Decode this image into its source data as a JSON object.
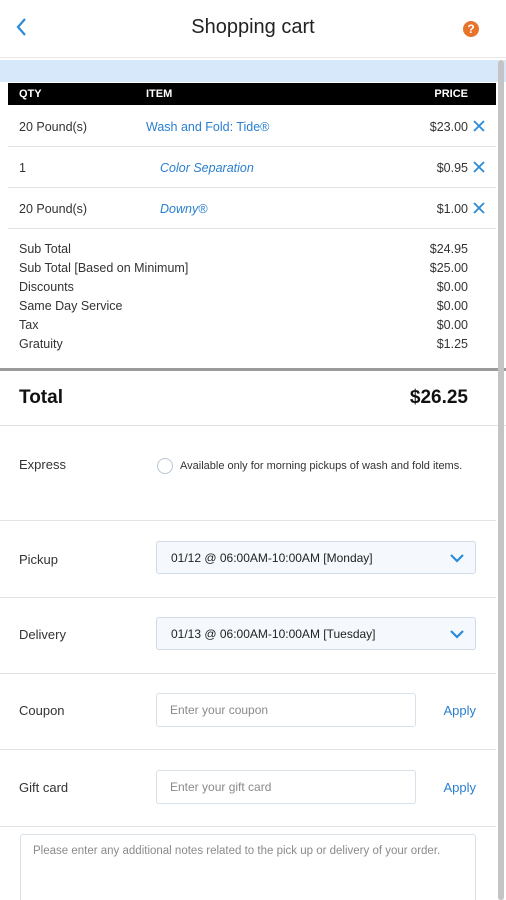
{
  "header": {
    "title": "Shopping cart",
    "help_glyph": "?"
  },
  "table": {
    "headers": {
      "qty": "QTY",
      "item": "ITEM",
      "price": "PRICE"
    },
    "rows": [
      {
        "qty": "20 Pound(s)",
        "item": "Wash and Fold: Tide®",
        "price": "$23.00"
      },
      {
        "qty": "1",
        "item": "Color Separation",
        "price": "$0.95"
      },
      {
        "qty": "20 Pound(s)",
        "item": "Downy®",
        "price": "$1.00"
      }
    ]
  },
  "summary": [
    {
      "label": "Sub Total",
      "value": "$24.95"
    },
    {
      "label": "Sub Total [Based on Minimum]",
      "value": "$25.00"
    },
    {
      "label": "Discounts",
      "value": "$0.00"
    },
    {
      "label": "Same Day Service",
      "value": "$0.00"
    },
    {
      "label": "Tax",
      "value": "$0.00"
    },
    {
      "label": "Gratuity",
      "value": "$1.25"
    }
  ],
  "total": {
    "label": "Total",
    "value": "$26.25"
  },
  "express": {
    "label": "Express",
    "note": "Available only for morning pickups of wash and fold items.",
    "checked": false
  },
  "pickup": {
    "label": "Pickup",
    "value": "01/12 @ 06:00AM-10:00AM [Monday]"
  },
  "delivery": {
    "label": "Delivery",
    "value": "01/13 @ 06:00AM-10:00AM [Tuesday]"
  },
  "coupon": {
    "label": "Coupon",
    "placeholder": "Enter your coupon",
    "apply_label": "Apply"
  },
  "giftcard": {
    "label": "Gift card",
    "placeholder": "Enter your gift card",
    "apply_label": "Apply"
  },
  "notes": {
    "placeholder": "Please enter any additional notes related to the pick up or delivery of your order."
  },
  "colors": {
    "accent": "#2a7fd0",
    "help": "#e8742c",
    "band": "#d6e8fa",
    "header_bar": "#000000"
  }
}
